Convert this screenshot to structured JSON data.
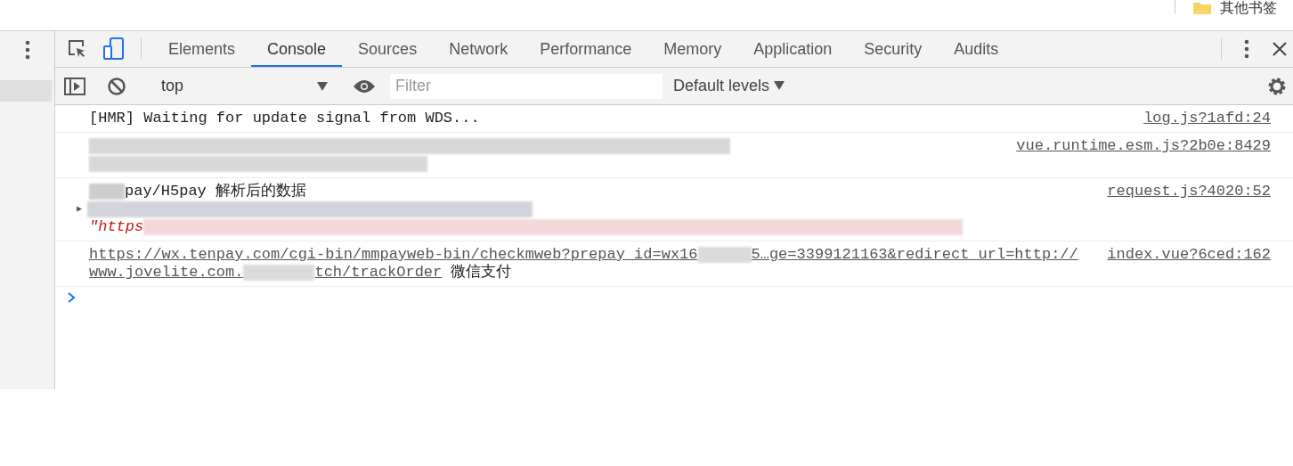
{
  "bookmarks_bar": {
    "label": "其他书签"
  },
  "tabs": [
    {
      "label": "Elements",
      "selected": false
    },
    {
      "label": "Console",
      "selected": true
    },
    {
      "label": "Sources",
      "selected": false
    },
    {
      "label": "Network",
      "selected": false
    },
    {
      "label": "Performance",
      "selected": false
    },
    {
      "label": "Memory",
      "selected": false
    },
    {
      "label": "Application",
      "selected": false
    },
    {
      "label": "Security",
      "selected": false
    },
    {
      "label": "Audits",
      "selected": false
    }
  ],
  "toolbar": {
    "context": "top",
    "filter": {
      "placeholder": "Filter"
    },
    "levels": "Default levels"
  },
  "messages": [
    {
      "lines": [
        [
          {
            "kind": "text",
            "text": "[HMR] Waiting for update signal from WDS..."
          }
        ]
      ],
      "source": "log.js?1afd:24"
    },
    {
      "lines": [
        [
          {
            "kind": "redacted",
            "color": "#d4d4d4"
          }
        ],
        [
          {
            "kind": "redacted",
            "color": "#d4d4d4"
          }
        ]
      ],
      "source": "vue.runtime.esm.js?2b0e:8429"
    },
    {
      "lines": [
        [
          {
            "kind": "redacted",
            "color": "#c8c8c8"
          },
          {
            "kind": "text",
            "text": "pay/H5pay 解析后的数据"
          }
        ],
        [
          {
            "kind": "toggle",
            "text": "▶"
          },
          {
            "kind": "redacted",
            "color": "#cfcfd8"
          }
        ],
        [
          {
            "kind": "string",
            "text": "\"https"
          },
          {
            "kind": "redacted",
            "color": "#f2d4d6"
          }
        ]
      ],
      "source": "request.js?4020:52"
    },
    {
      "lines": [
        [
          {
            "kind": "link",
            "text": "https://wx.tenpay.com/cgi-bin/mmpayweb-bin/checkmweb?prepay_id=wx16"
          },
          {
            "kind": "redacted",
            "color": "#d8d8d8"
          },
          {
            "kind": "link",
            "text": "5…ge=3399121163&redirect_url=http://"
          }
        ],
        [
          {
            "kind": "link",
            "text": "www.jovelite.com."
          },
          {
            "kind": "redacted",
            "color": "#d8d8d8"
          },
          {
            "kind": "link",
            "text": "tch/trackOrder"
          },
          {
            "kind": "text",
            "text": " 微信支付"
          }
        ]
      ],
      "source": "index.vue?6ced:162"
    }
  ]
}
